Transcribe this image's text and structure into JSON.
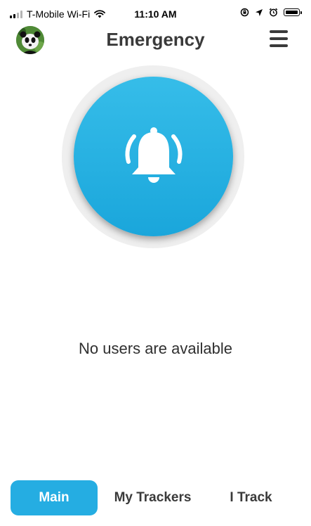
{
  "status_bar": {
    "carrier": "T-Mobile Wi-Fi",
    "time": "11:10 AM",
    "icons": [
      "signal-bars-icon",
      "wifi-icon",
      "orientation-lock-icon",
      "location-arrow-icon",
      "alarm-icon",
      "battery-icon"
    ]
  },
  "header": {
    "title": "Emergency",
    "avatar_icon": "panda-avatar",
    "menu_icon": "hamburger-menu-icon"
  },
  "emergency_button": {
    "icon": "bell-ringing-icon",
    "color": "#25ade2"
  },
  "main": {
    "empty_message": "No users are available"
  },
  "tabs": [
    {
      "label": "Main",
      "active": true
    },
    {
      "label": "My Trackers",
      "active": false
    },
    {
      "label": "I Track",
      "active": false
    }
  ],
  "colors": {
    "accent": "#25ade2",
    "text": "#3a3a3a",
    "ring": "#efefef"
  }
}
